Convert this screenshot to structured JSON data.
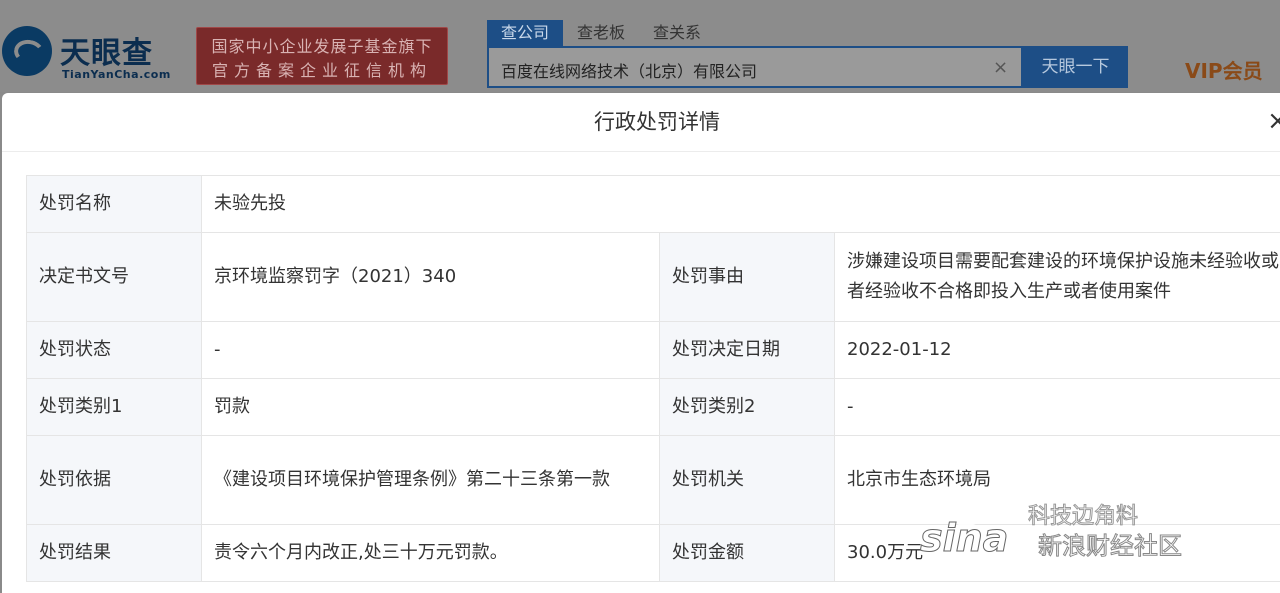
{
  "header": {
    "logo_text": "天眼查",
    "logo_sub": "TianYanCha.com",
    "gov_badge_line1": "国家中小企业发展子基金旗下",
    "gov_badge_line2": "官方备案企业征信机构",
    "search_tabs": [
      "查公司",
      "查老板",
      "查关系"
    ],
    "search_value": "百度在线网络技术（北京）有限公司",
    "clear_symbol": "×",
    "search_button": "天眼一下",
    "vip_label": "VIP会员"
  },
  "modal": {
    "title": "行政处罚详情",
    "close_symbol": "×",
    "rows": [
      {
        "label": "处罚名称",
        "value": "未验先投"
      },
      {
        "label": "决定书文号",
        "value": "京环境监察罚字（2021）340",
        "label2": "处罚事由",
        "value2": "涉嫌建设项目需要配套建设的环境保护设施未经验收或者经验收不合格即投入生产或者使用案件"
      },
      {
        "label": "处罚状态",
        "value": "-",
        "label2": "处罚决定日期",
        "value2": "2022-01-12"
      },
      {
        "label": "处罚类别1",
        "value": "罚款",
        "label2": "处罚类别2",
        "value2": "-"
      },
      {
        "label": "处罚依据",
        "value": "《建设项目环境保护管理条例》第二十三条第一款",
        "label2": "处罚机关",
        "value2": "北京市生态环境局"
      },
      {
        "label": "处罚结果",
        "value": "责令六个月内改正,处三十万元罚款。",
        "label2": "处罚金额",
        "value2": "30.0万元"
      }
    ]
  },
  "watermark": {
    "logo": "sina",
    "text": "新浪财经社区",
    "channel": "科技边角料"
  }
}
